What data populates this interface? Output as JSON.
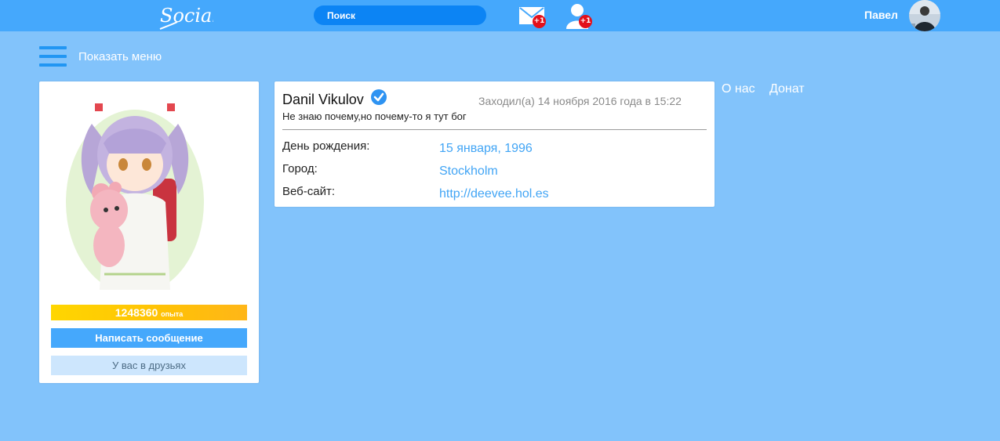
{
  "header": {
    "logo_text": "Social",
    "search_placeholder": "Поиск",
    "mail_badge": "+1",
    "friends_badge": "+1",
    "username": "Павел"
  },
  "menu": {
    "label": "Показать меню"
  },
  "profile": {
    "xp_value": "1248360",
    "xp_unit": "опыта",
    "message_button": "Написать сообщение",
    "friend_button": "У вас в друзьях"
  },
  "info": {
    "name": "Danil Vikulov",
    "last_seen": "Заходил(а) 14 ноября 2016 года в 15:22",
    "status": "Не знаю почему,но почему-то я тут бог",
    "rows": [
      {
        "label": "День рождения:",
        "value": "15 января, 1996"
      },
      {
        "label": "Город:",
        "value": "Stockholm"
      },
      {
        "label": "Веб-сайт:",
        "value": "http://deevee.hol.es"
      }
    ]
  },
  "links": {
    "about": "О нас",
    "donate": "Донат"
  },
  "colors": {
    "background": "#82c3fb",
    "topbar": "#45a8fc",
    "search": "#0c84f4",
    "badge": "#e3101b",
    "accent_link": "#42a5f5",
    "xp_bar": "#ffc107"
  },
  "icons": [
    "logo",
    "mail-icon",
    "friend-request-icon",
    "verified-icon",
    "menu-icon"
  ]
}
